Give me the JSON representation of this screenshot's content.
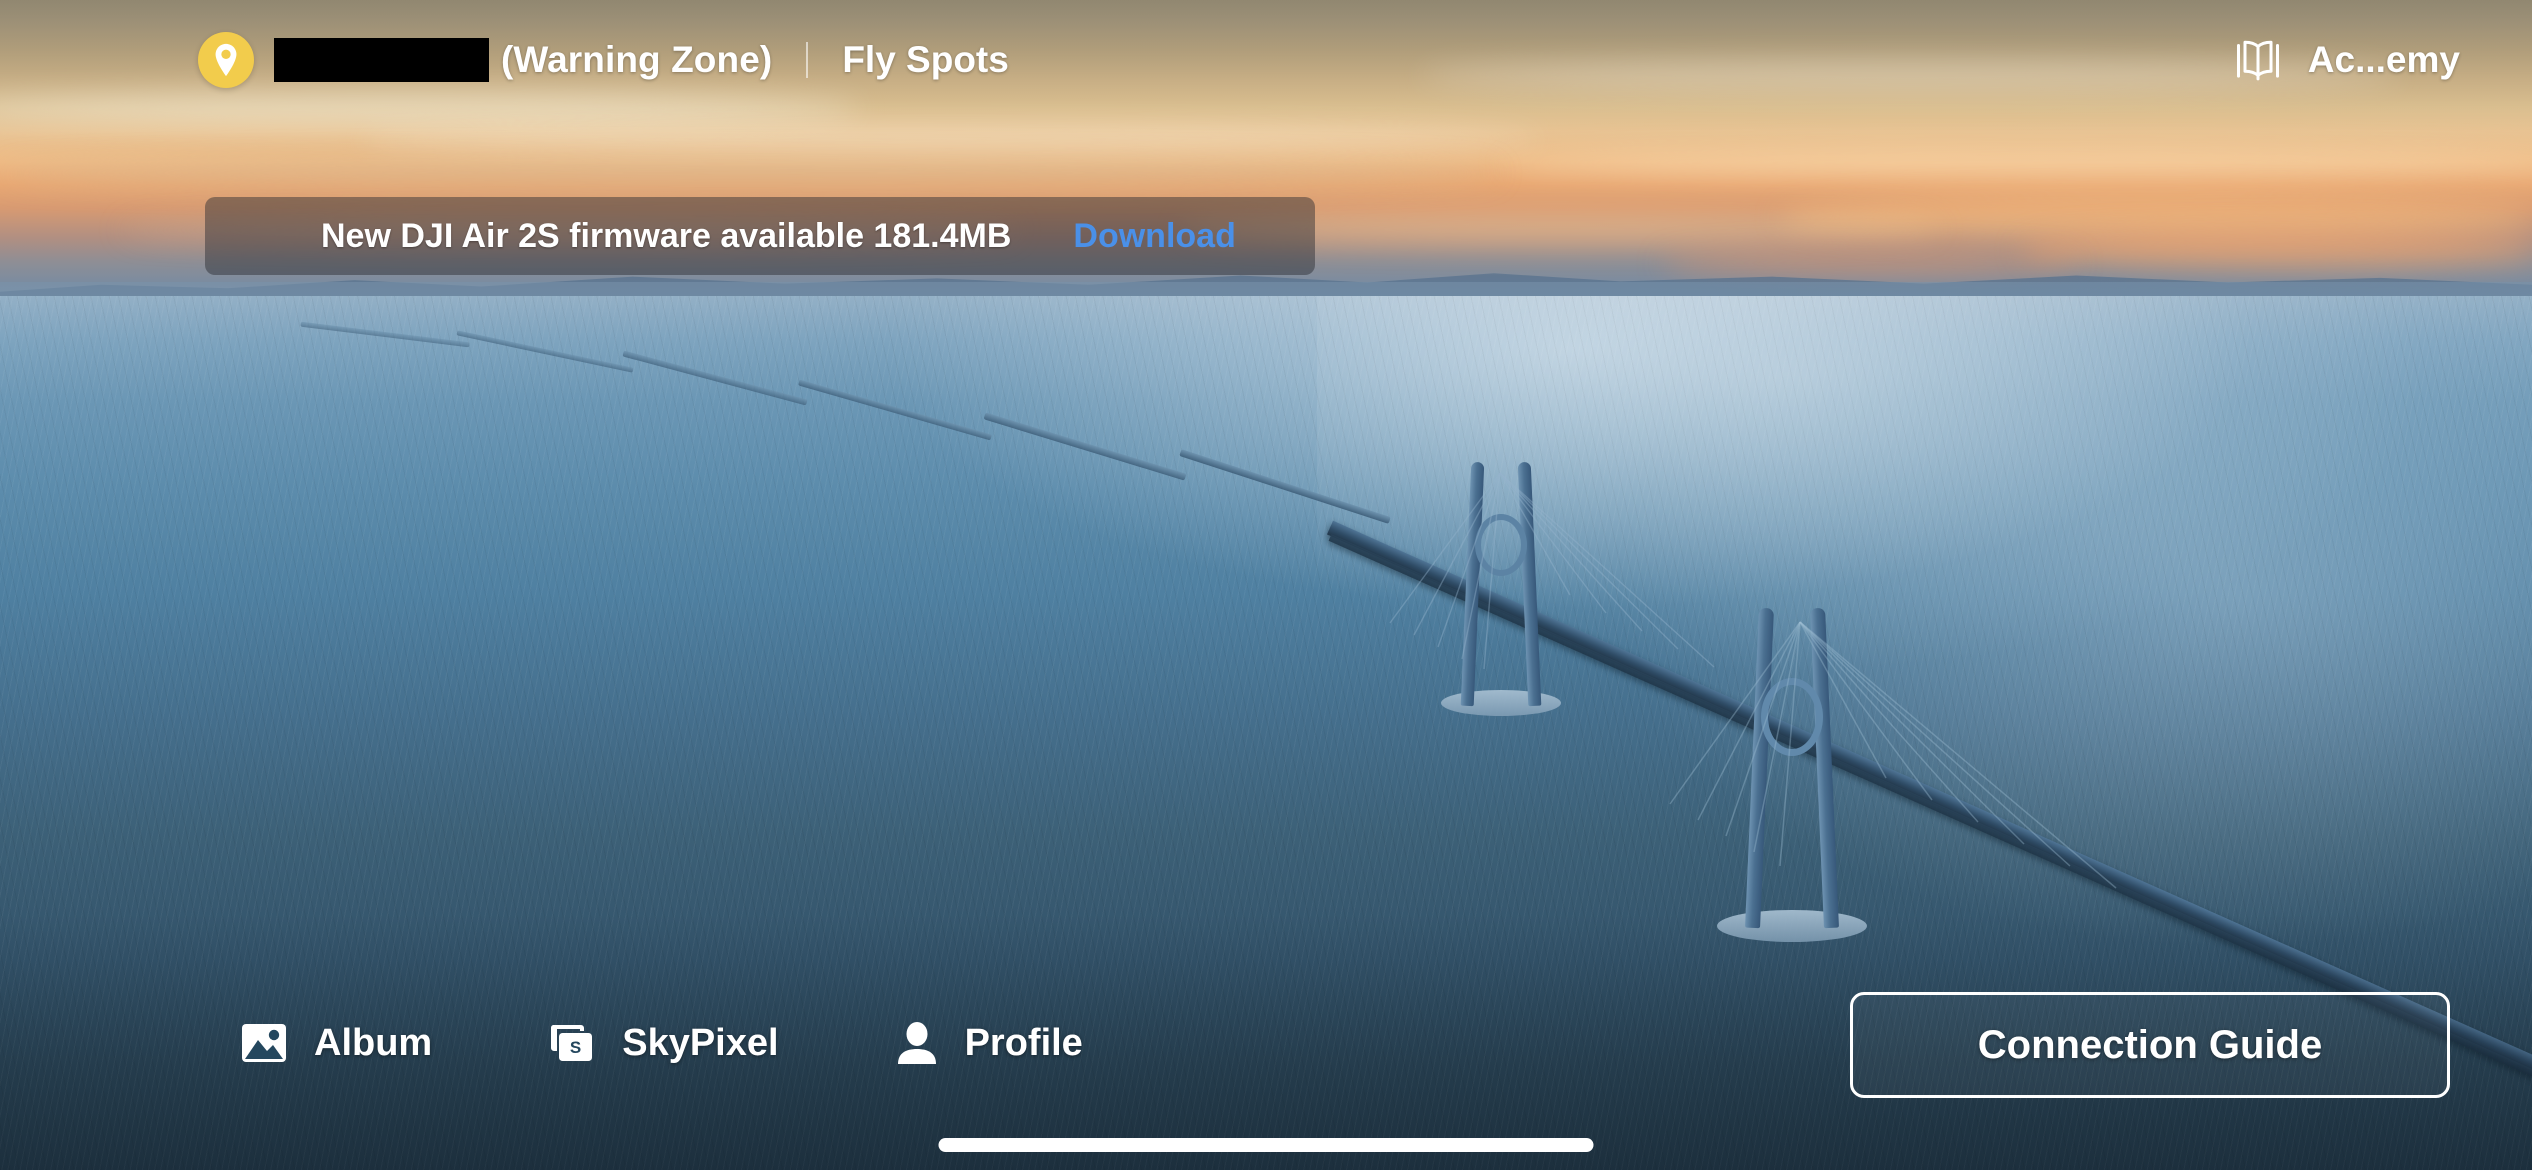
{
  "app": {
    "name": "DJI Fly",
    "accent_blue": "#4a90e8",
    "pin_yellow": "#f2cc4c"
  },
  "topbar": {
    "location_pin_icon": "location-pin-icon",
    "location_name_redacted": "",
    "zone_label": "(Warning Zone)",
    "separator": "|",
    "fly_spots_label": "Fly Spots",
    "academy_icon": "open-book-icon",
    "academy_label": "Ac...emy"
  },
  "firmware_banner": {
    "message": "New DJI Air 2S firmware available 181.4MB",
    "download_label": "Download",
    "download_color": "#4a90e8"
  },
  "bottombar": {
    "items": [
      {
        "label": "Album",
        "icon": "photo-album-icon"
      },
      {
        "label": "SkyPixel",
        "icon": "skypixel-icon"
      },
      {
        "label": "Profile",
        "icon": "person-icon"
      }
    ],
    "connection_guide_label": "Connection Guide"
  },
  "system": {
    "home_indicator": "home-indicator-bar"
  }
}
